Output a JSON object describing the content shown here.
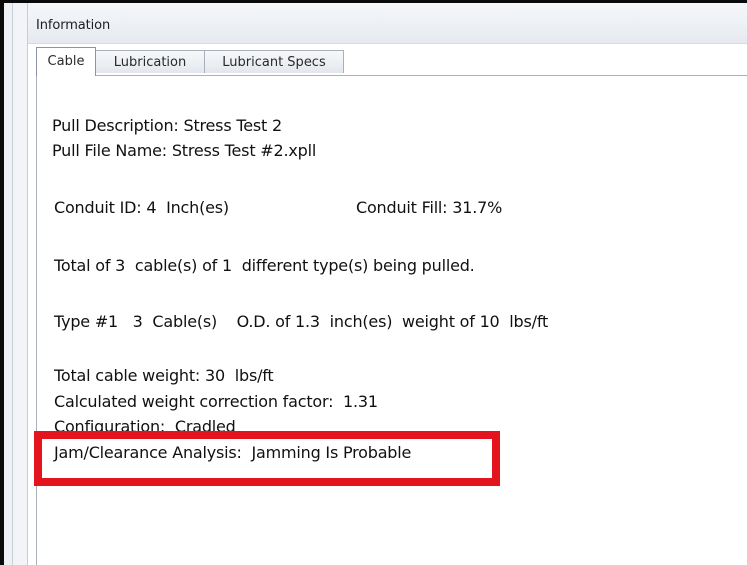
{
  "panel": {
    "title": "Information"
  },
  "tabs": [
    {
      "label": "Cable",
      "active": true
    },
    {
      "label": "Lubrication",
      "active": false
    },
    {
      "label": "Lubricant Specs",
      "active": false
    }
  ],
  "content": {
    "pull_description": "Pull Description: Stress Test 2",
    "pull_file_name": "Pull File Name: Stress Test #2.xpll",
    "conduit_id": "Conduit ID: 4  Inch(es)",
    "conduit_fill": "Conduit Fill: 31.7%",
    "total_cables": "Total of 3  cable(s) of 1  different type(s) being pulled.",
    "type_line": "Type #1   3  Cable(s)    O.D. of 1.3  inch(es)  weight of 10  lbs/ft",
    "total_weight": "Total cable weight: 30  lbs/ft",
    "correction_factor": "Calculated weight correction factor:  1.31",
    "configuration": "Configuration:  Cradled",
    "jam_analysis": "Jam/Clearance Analysis:  Jamming Is Probable"
  },
  "colors": {
    "highlight": "#e3141d",
    "frame": "#0a0a0a"
  }
}
